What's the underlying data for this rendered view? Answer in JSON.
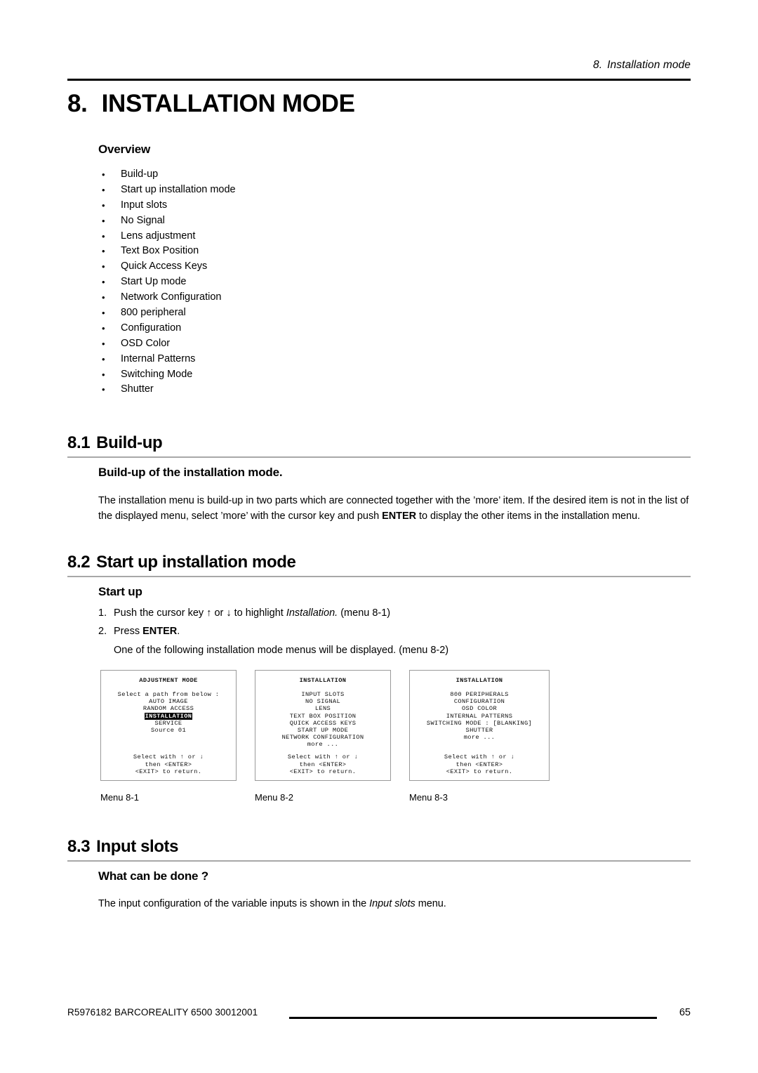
{
  "header": {
    "running_number": "8.",
    "running_title": "Installation mode"
  },
  "chapter": {
    "number": "8.",
    "title": "INSTALLATION MODE"
  },
  "overview": {
    "heading": "Overview",
    "bullet": "•",
    "items": [
      "Build-up",
      "Start up installation mode",
      "Input slots",
      "No Signal",
      "Lens adjustment",
      "Text Box Position",
      "Quick Access Keys",
      "Start Up mode",
      "Network Configuration",
      "800 peripheral",
      "Configuration",
      "OSD Color",
      "Internal Patterns",
      "Switching Mode",
      "Shutter"
    ]
  },
  "section_8_1": {
    "number": "8.1",
    "title": "Build-up",
    "sub_heading": "Build-up of the installation mode.",
    "paragraph_part1": "The installation menu is build-up in two parts which are connected together with the ’more’ item. If the desired item is not in the list of the displayed menu, select ’more’ with the cursor key and push ",
    "paragraph_bold": "ENTER",
    "paragraph_part2": " to display the other items in the installation menu."
  },
  "section_8_2": {
    "number": "8.2",
    "title": "Start up installation mode",
    "sub_heading": "Start up",
    "step1_num": "1.",
    "step1_pre": "Push the cursor key ↑ or ↓ to highlight ",
    "step1_italic": "Installation.",
    "step1_post": " (menu 8-1)",
    "step2_num": "2.",
    "step2_pre": "Press ",
    "step2_bold": "ENTER",
    "step2_post": ".",
    "step2_note": "One of the following installation mode menus will be displayed. (menu 8-2)"
  },
  "section_8_3": {
    "number": "8.3",
    "title": "Input slots",
    "sub_heading": "What can be done ?",
    "paragraph_part1": "The input configuration of the variable inputs is shown in the ",
    "paragraph_italic": "Input slots",
    "paragraph_part2": " menu."
  },
  "menus": [
    {
      "caption": "Menu 8-1",
      "title": "ADJUSTMENT MODE",
      "items": [
        {
          "text": "Select a path from below :",
          "highlighted": false
        },
        {
          "text": "AUTO IMAGE",
          "highlighted": false
        },
        {
          "text": "RANDOM ACCESS",
          "highlighted": false
        },
        {
          "text": "INSTALLATION",
          "highlighted": true
        },
        {
          "text": "SERVICE",
          "highlighted": false
        },
        {
          "text": "Source 01",
          "highlighted": false
        }
      ],
      "footer": [
        "Select with ↑ or ↓",
        "then <ENTER>",
        "<EXIT> to return."
      ]
    },
    {
      "caption": "Menu 8-2",
      "title": "INSTALLATION",
      "items": [
        {
          "text": "INPUT SLOTS",
          "highlighted": false
        },
        {
          "text": "NO SIGNAL",
          "highlighted": false
        },
        {
          "text": "LENS",
          "highlighted": false
        },
        {
          "text": "TEXT BOX POSITION",
          "highlighted": false
        },
        {
          "text": "QUICK ACCESS KEYS",
          "highlighted": false
        },
        {
          "text": "START UP MODE",
          "highlighted": false
        },
        {
          "text": "NETWORK CONFIGURATION",
          "highlighted": false
        },
        {
          "text": "more ...",
          "highlighted": false
        }
      ],
      "footer": [
        "Select with ↑ or ↓",
        "then <ENTER>",
        "<EXIT> to return."
      ]
    },
    {
      "caption": "Menu 8-3",
      "title": "INSTALLATION",
      "items": [
        {
          "text": "800 PERIPHERALS",
          "highlighted": false
        },
        {
          "text": "CONFIGURATION",
          "highlighted": false
        },
        {
          "text": "OSD COLOR",
          "highlighted": false
        },
        {
          "text": "INTERNAL PATTERNS",
          "highlighted": false
        },
        {
          "text": "SWITCHING MODE : [BLANKING]",
          "highlighted": false
        },
        {
          "text": "SHUTTER",
          "highlighted": false
        },
        {
          "text": "more ...",
          "highlighted": false
        }
      ],
      "footer": [
        "Select with ↑ or ↓",
        "then <ENTER>",
        "<EXIT> to return."
      ]
    }
  ],
  "footer": {
    "doc_reference": "R5976182  BARCOREALITY 6500  30012001",
    "page_number": "65"
  }
}
